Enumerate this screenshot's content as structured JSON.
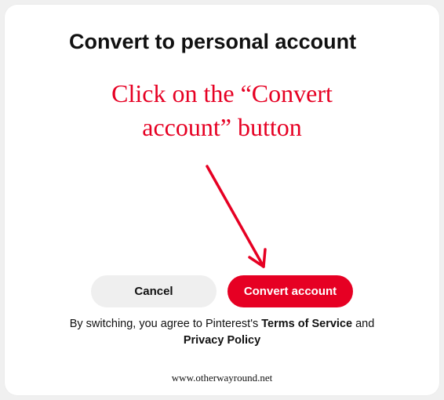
{
  "dialog": {
    "title": "Convert to personal account"
  },
  "annotation": {
    "line1": "Click on the “Convert",
    "line2": "account” button"
  },
  "buttons": {
    "cancel": "Cancel",
    "convert": "Convert account"
  },
  "disclaimer": {
    "prefix": "By switching, you agree to Pinterest's ",
    "tos": "Terms of Service",
    "mid": " and ",
    "privacy": "Privacy Policy"
  },
  "attribution": "www.otherwayround.net"
}
